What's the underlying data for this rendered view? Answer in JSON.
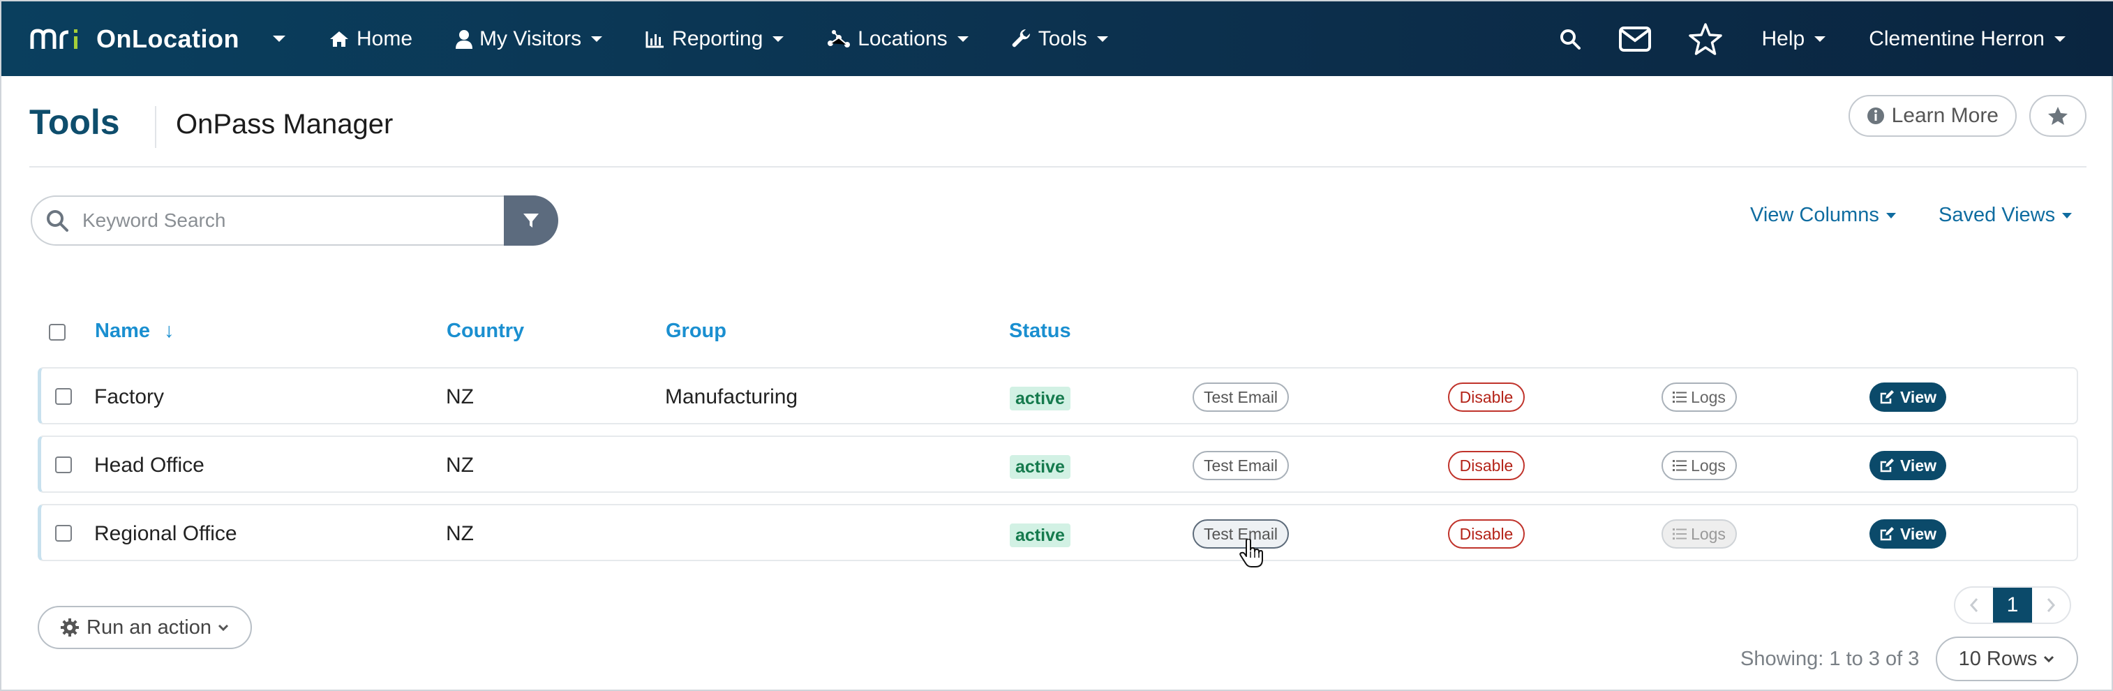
{
  "navbar": {
    "brand": "OnLocation",
    "items": [
      {
        "label": "Home",
        "icon": "home-icon",
        "has_dropdown": false
      },
      {
        "label": "My Visitors",
        "icon": "user-icon",
        "has_dropdown": true
      },
      {
        "label": "Reporting",
        "icon": "bar-chart-icon",
        "has_dropdown": true
      },
      {
        "label": "Locations",
        "icon": "network-icon",
        "has_dropdown": true
      },
      {
        "label": "Tools",
        "icon": "wrench-icon",
        "has_dropdown": true
      }
    ],
    "help_label": "Help",
    "user_name": "Clementine Herron"
  },
  "header": {
    "title": "Tools",
    "subtitle": "OnPass Manager",
    "learn_more_label": "Learn More"
  },
  "search": {
    "placeholder": "Keyword Search",
    "value": ""
  },
  "toolbar": {
    "view_columns_label": "View Columns",
    "saved_views_label": "Saved Views"
  },
  "table": {
    "columns": {
      "name": "Name",
      "sort_indicator": "↓",
      "country": "Country",
      "group": "Group",
      "status": "Status"
    },
    "rows": [
      {
        "name": "Factory",
        "country": "NZ",
        "group": "Manufacturing",
        "status": "active",
        "test_email": "Test Email",
        "disable": "Disable",
        "logs": "Logs",
        "view": "View"
      },
      {
        "name": "Head Office",
        "country": "NZ",
        "group": "",
        "status": "active",
        "test_email": "Test Email",
        "disable": "Disable",
        "logs": "Logs",
        "view": "View"
      },
      {
        "name": "Regional Office",
        "country": "NZ",
        "group": "",
        "status": "active",
        "test_email": "Test Email",
        "disable": "Disable",
        "logs": "Logs",
        "view": "View"
      }
    ]
  },
  "footer": {
    "run_action_label": "Run an action",
    "current_page": "1",
    "showing_text": "Showing: 1 to 3 of 3",
    "rows_per_page": "10 Rows"
  },
  "colors": {
    "navbar_bg": "#0c2f4c",
    "title": "#0e4d6c",
    "link": "#0f6ca0",
    "header_link": "#1a8fd0",
    "status_active_bg": "#d2f1e4",
    "status_active_text": "#157a4d",
    "danger": "#b42318",
    "primary_button": "#0b4a6a"
  }
}
